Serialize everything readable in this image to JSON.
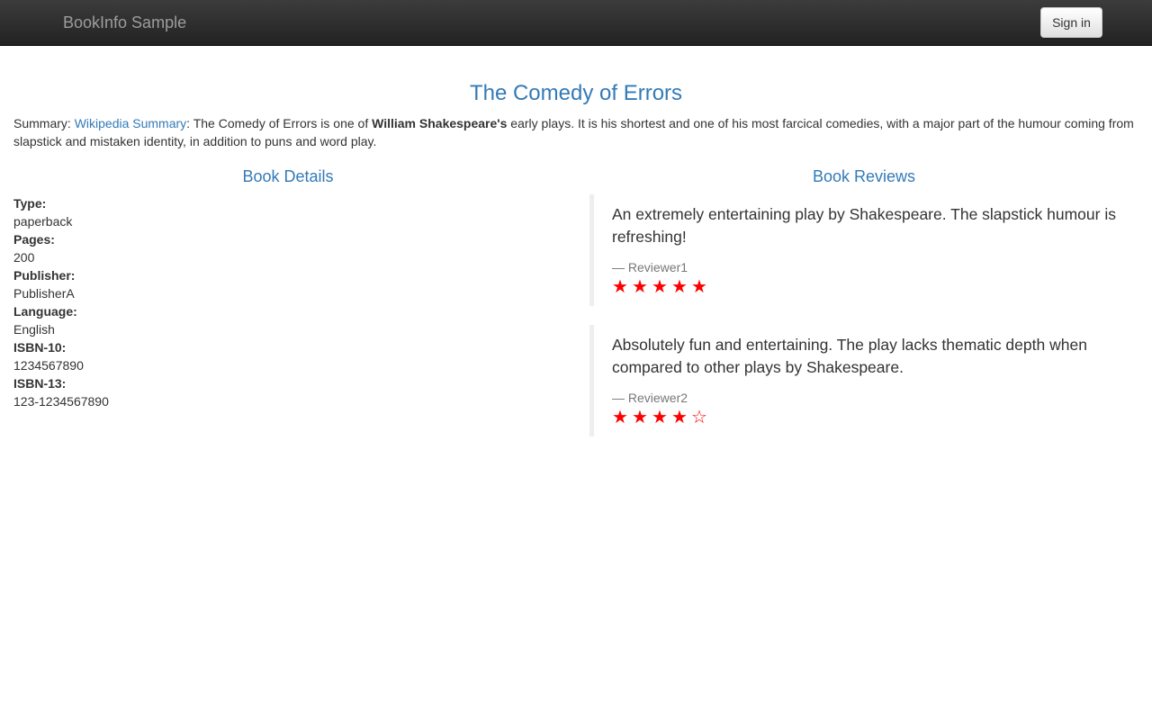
{
  "navbar": {
    "brand": "BookInfo Sample",
    "sign_in_label": "Sign in"
  },
  "book": {
    "title": "The Comedy of Errors",
    "summary": {
      "prefix": "Summary: ",
      "link_text": "Wikipedia Summary",
      "text_before_bold": ": The Comedy of Errors is one of ",
      "bold_text": "William Shakespeare's",
      "text_after_bold": " early plays. It is his shortest and one of his most farcical comedies, with a major part of the humour coming from slapstick and mistaken identity, in addition to puns and word play."
    }
  },
  "details": {
    "heading": "Book Details",
    "fields": [
      {
        "label": "Type:",
        "value": "paperback"
      },
      {
        "label": "Pages:",
        "value": "200"
      },
      {
        "label": "Publisher:",
        "value": "PublisherA"
      },
      {
        "label": "Language:",
        "value": "English"
      },
      {
        "label": "ISBN-10:",
        "value": "1234567890"
      },
      {
        "label": "ISBN-13:",
        "value": "123-1234567890"
      }
    ]
  },
  "reviews": {
    "heading": "Book Reviews",
    "star_color": "#ff0000",
    "items": [
      {
        "text": "An extremely entertaining play by Shakespeare. The slapstick humour is refreshing!",
        "reviewer": "— Reviewer1",
        "rating": 5,
        "max_rating": 5
      },
      {
        "text": "Absolutely fun and entertaining. The play lacks thematic depth when compared to other plays by Shakespeare.",
        "reviewer": "— Reviewer2",
        "rating": 4,
        "max_rating": 5
      }
    ]
  },
  "colors": {
    "link": "#337ab7",
    "navbar_bg": "#222222",
    "brand_text": "#9d9d9d",
    "review_border": "#eeeeee"
  }
}
